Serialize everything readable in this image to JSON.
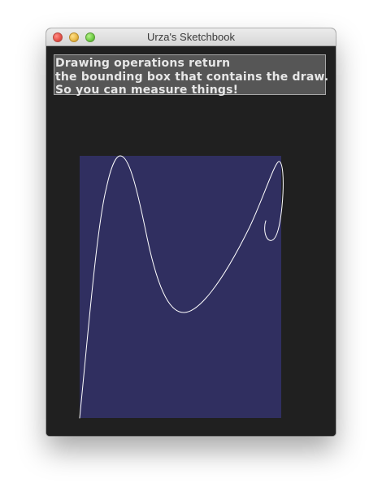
{
  "window": {
    "title": "Urza's Sketchbook"
  },
  "message": {
    "lines": [
      "Drawing operations return",
      "the bounding box that contains the draw.",
      "So you can measure things!"
    ]
  },
  "colors": {
    "window_background": "#202020",
    "message_background": "#565656",
    "message_border": "#a7a7a7",
    "bounding_box_fill": "#302f60",
    "curve_stroke": "#ffffff"
  },
  "icons": {
    "close": "close-traffic-light-icon",
    "minimize": "minimize-traffic-light-icon",
    "zoom": "zoom-traffic-light-icon"
  }
}
